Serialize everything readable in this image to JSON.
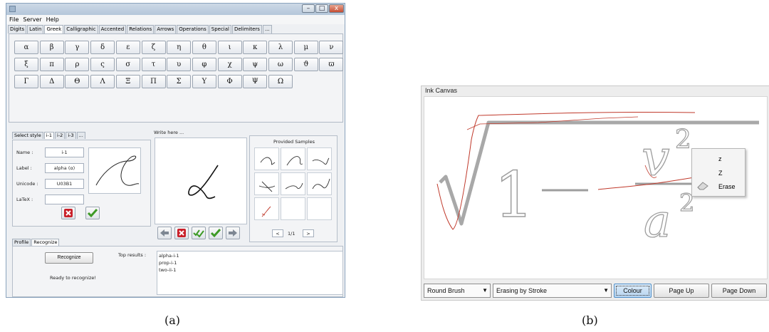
{
  "panel_a": {
    "window": {
      "title": "",
      "minimize": "–",
      "maximize": "□",
      "close": "x"
    },
    "menu": [
      "File",
      "Server",
      "Help"
    ],
    "tabs": [
      "Digits",
      "Latin",
      "Greek",
      "Calligraphic",
      "Accented",
      "Relations",
      "Arrows",
      "Operations",
      "Special",
      "Delimiters",
      "..."
    ],
    "active_tab": "Greek",
    "symbols": {
      "row1": [
        "α",
        "β",
        "γ",
        "δ",
        "ε",
        "ζ",
        "η",
        "θ",
        "ι",
        "κ",
        "λ",
        "μ",
        "ν"
      ],
      "row2": [
        "ξ",
        "π",
        "ρ",
        "ς",
        "σ",
        "τ",
        "υ",
        "φ",
        "χ",
        "ψ",
        "ω",
        "ϑ",
        "ϖ"
      ],
      "row3": [
        "Γ",
        "Δ",
        "Θ",
        "Λ",
        "Ξ",
        "Π",
        "Σ",
        "Υ",
        "Φ",
        "Ψ",
        "Ω"
      ]
    },
    "style_tabs": [
      "Select style",
      "i-1",
      "i-2",
      "i-3",
      "..."
    ],
    "form": {
      "name_label": "Name :",
      "name_value": "i-1",
      "label_label": "Label :",
      "label_value": "alpha (α)",
      "unicode_label": "Unicode :",
      "unicode_value": "U03B1",
      "latex_label": "LaTeX :",
      "latex_value": ""
    },
    "write_here": "Write here ...",
    "provided_samples": {
      "title": "Provided Samples",
      "page": "1/1",
      "prev": "<",
      "next": ">"
    },
    "bottom_tabs": [
      "Profile",
      "Recognize"
    ],
    "recognize": {
      "button": "Recognize",
      "status": "Ready to recognize!",
      "top_results_label": "Top results :",
      "results": [
        "alpha-i-1",
        "prop-i-1",
        "two-ii-1"
      ]
    },
    "icons": {
      "reject": "red-x-icon",
      "accept": "green-check-icon",
      "prev": "arrow-left-icon",
      "next": "arrow-right-icon"
    },
    "caption": "(a)"
  },
  "panel_b": {
    "title": "Ink Canvas",
    "context_menu": [
      "z",
      "Z",
      "Erase"
    ],
    "toolbar": {
      "brush": "Round Brush",
      "erase_mode": "Erasing by Stroke",
      "colour": "Colour",
      "page_up": "Page Up",
      "page_down": "Page Down"
    },
    "caption": "(b)"
  }
}
